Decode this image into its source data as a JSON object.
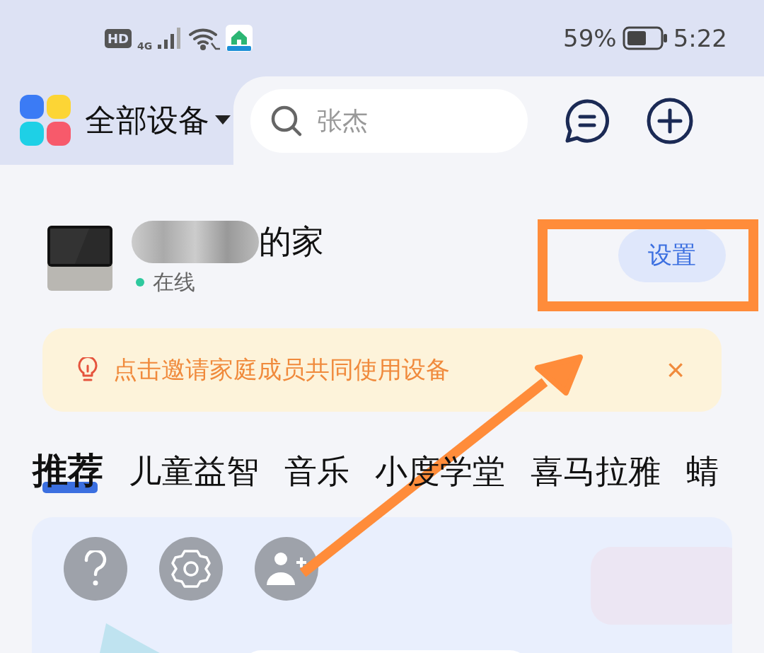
{
  "status_bar": {
    "hd": "HD",
    "network": "4G",
    "battery": "59%",
    "time": "5:22"
  },
  "header": {
    "title": "全部设备",
    "search": {
      "placeholder": "张杰"
    }
  },
  "home": {
    "name": "的家",
    "status": "在线",
    "online": true,
    "button": "设置"
  },
  "banner": {
    "text": "点击邀请家庭成员共同使用设备",
    "close": "×"
  },
  "tabs": [
    {
      "label": "推荐",
      "selected": true
    },
    {
      "label": "儿童益智",
      "selected": false
    },
    {
      "label": "音乐",
      "selected": false
    },
    {
      "label": "小度学堂",
      "selected": false
    },
    {
      "label": "喜马拉雅",
      "selected": false
    },
    {
      "label": "蜻",
      "selected": false
    }
  ],
  "card": {
    "actions": [
      {
        "kind": "help"
      },
      {
        "kind": "settings"
      },
      {
        "kind": "add-user"
      }
    ]
  }
}
